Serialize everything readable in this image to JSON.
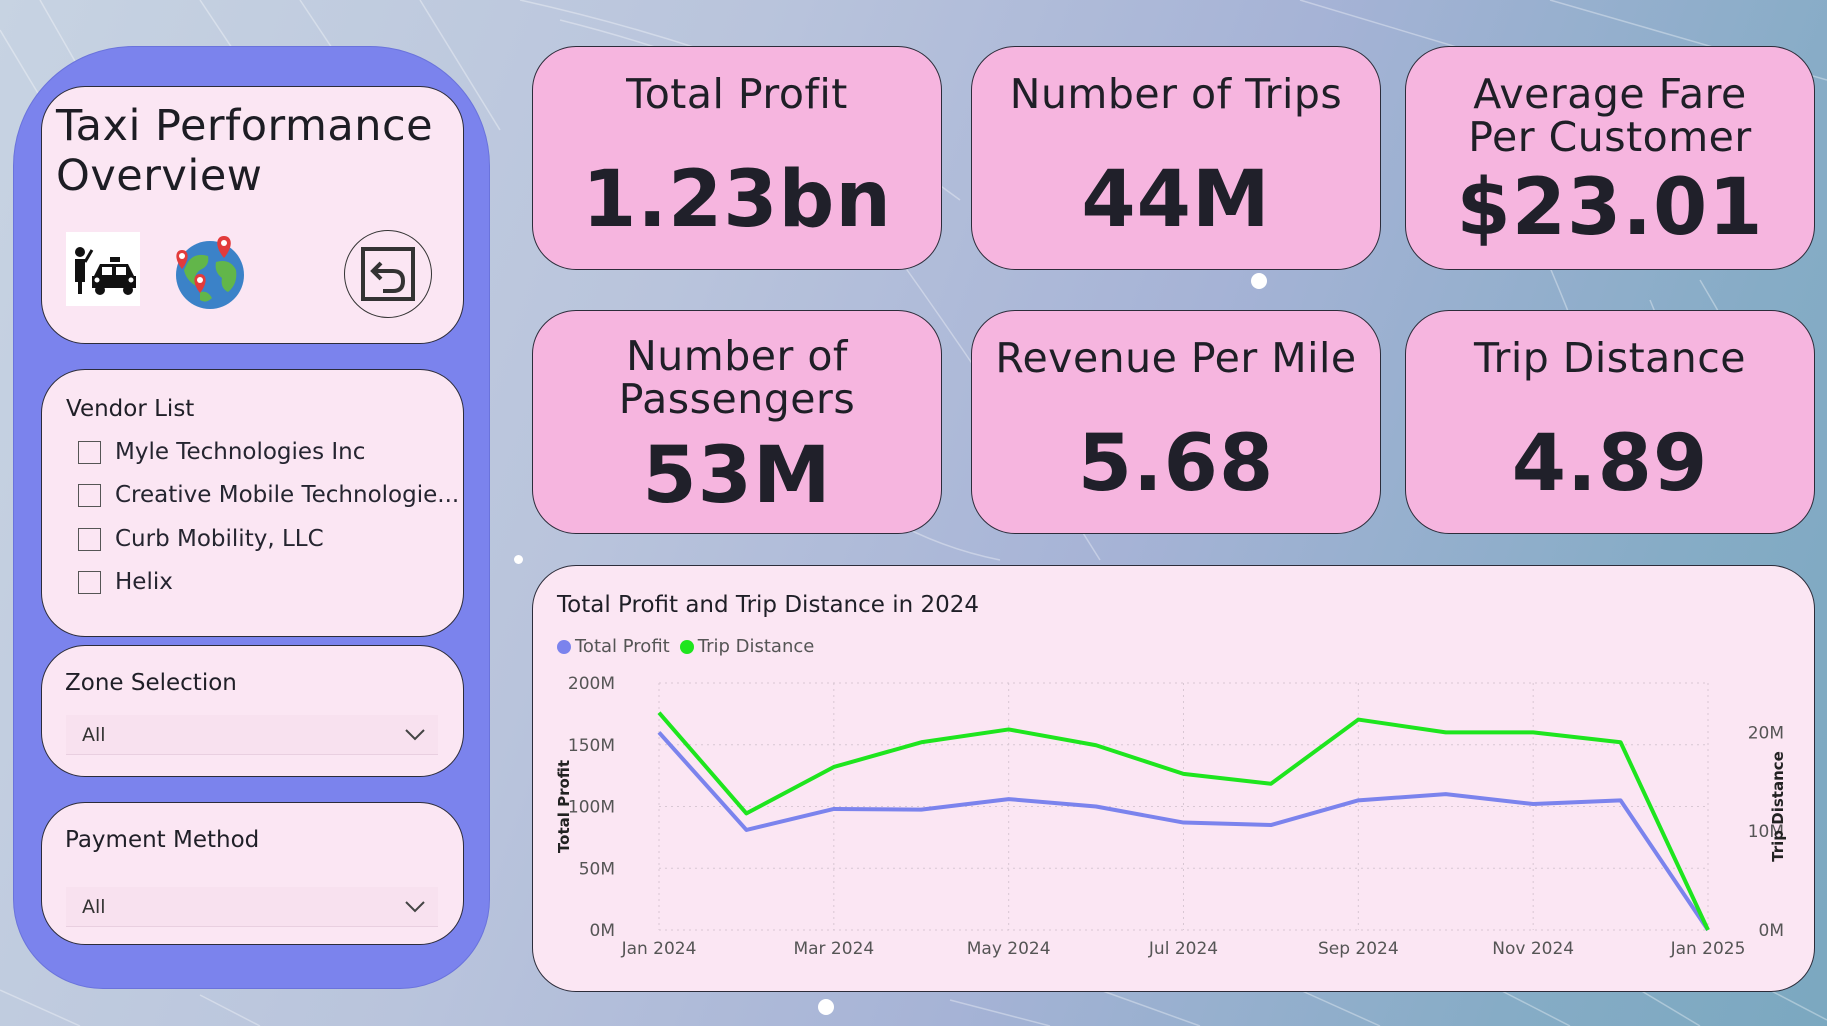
{
  "sidebar": {
    "title": "Taxi Performance Overview",
    "icons": [
      "taxi-passenger-icon",
      "globe-pins-icon",
      "back-arrow-icon"
    ],
    "vendor_list": {
      "title": "Vendor List",
      "items": [
        {
          "label": "Myle Technologies Inc",
          "checked": false
        },
        {
          "label": "Creative Mobile Technologie...",
          "checked": false
        },
        {
          "label": "Curb Mobility, LLC",
          "checked": false
        },
        {
          "label": "Helix",
          "checked": false
        }
      ]
    },
    "zone_selection": {
      "title": "Zone Selection",
      "value": "All"
    },
    "payment_method": {
      "title": "Payment Method",
      "value": "All"
    }
  },
  "kpis": [
    {
      "label": "Total Profit",
      "value": "1.23bn"
    },
    {
      "label": "Number of Trips",
      "value": "44M"
    },
    {
      "label": "Average Fare Per Customer",
      "value": "$23.01"
    },
    {
      "label": "Number of Passengers",
      "value": "53M"
    },
    {
      "label": "Revenue Per Mile",
      "value": "5.68"
    },
    {
      "label": "Trip Distance",
      "value": "4.89"
    }
  ],
  "colors": {
    "panel": "#7b83ed",
    "card": "#fbe6f3",
    "kpi_card": "#f6b5df",
    "total_profit_series": "#7b83ed",
    "trip_distance_series": "#1ee51e"
  },
  "chart_data": {
    "type": "line",
    "title": "Total Profit and Trip Distance in 2024",
    "x": [
      "Jan 2024",
      "Feb 2024",
      "Mar 2024",
      "Apr 2024",
      "May 2024",
      "Jun 2024",
      "Jul 2024",
      "Aug 2024",
      "Sep 2024",
      "Oct 2024",
      "Nov 2024",
      "Dec 2024",
      "Jan 2025"
    ],
    "xticks": [
      "Jan 2024",
      "Mar 2024",
      "May 2024",
      "Jul 2024",
      "Sep 2024",
      "Nov 2024",
      "Jan 2025"
    ],
    "series": [
      {
        "name": "Total Profit",
        "axis": "left",
        "color": "#7b83ed",
        "values": [
          160000000,
          81000000,
          98000000,
          97500000,
          106000000,
          100000000,
          87000000,
          85000000,
          105000000,
          110000000,
          102000000,
          105000000,
          0
        ]
      },
      {
        "name": "Trip Distance",
        "axis": "right",
        "color": "#1ee51e",
        "values": [
          22000000,
          11800000,
          16500000,
          19000000,
          20300000,
          18700000,
          15800000,
          14800000,
          21300000,
          20000000,
          20000000,
          19000000,
          0
        ]
      }
    ],
    "ylabel": "Total Profit",
    "y2label": "Trip Distance",
    "ylim": [
      0,
      200000000
    ],
    "y2lim": [
      0,
      25000000
    ],
    "yticks": [
      "0M",
      "50M",
      "100M",
      "150M",
      "200M"
    ],
    "yticks_values": [
      0,
      50000000,
      100000000,
      150000000,
      200000000
    ],
    "y2ticks": [
      "0M",
      "10M",
      "20M"
    ],
    "y2ticks_values": [
      0,
      10000000,
      20000000
    ],
    "grid": true,
    "legend": "top-left"
  }
}
